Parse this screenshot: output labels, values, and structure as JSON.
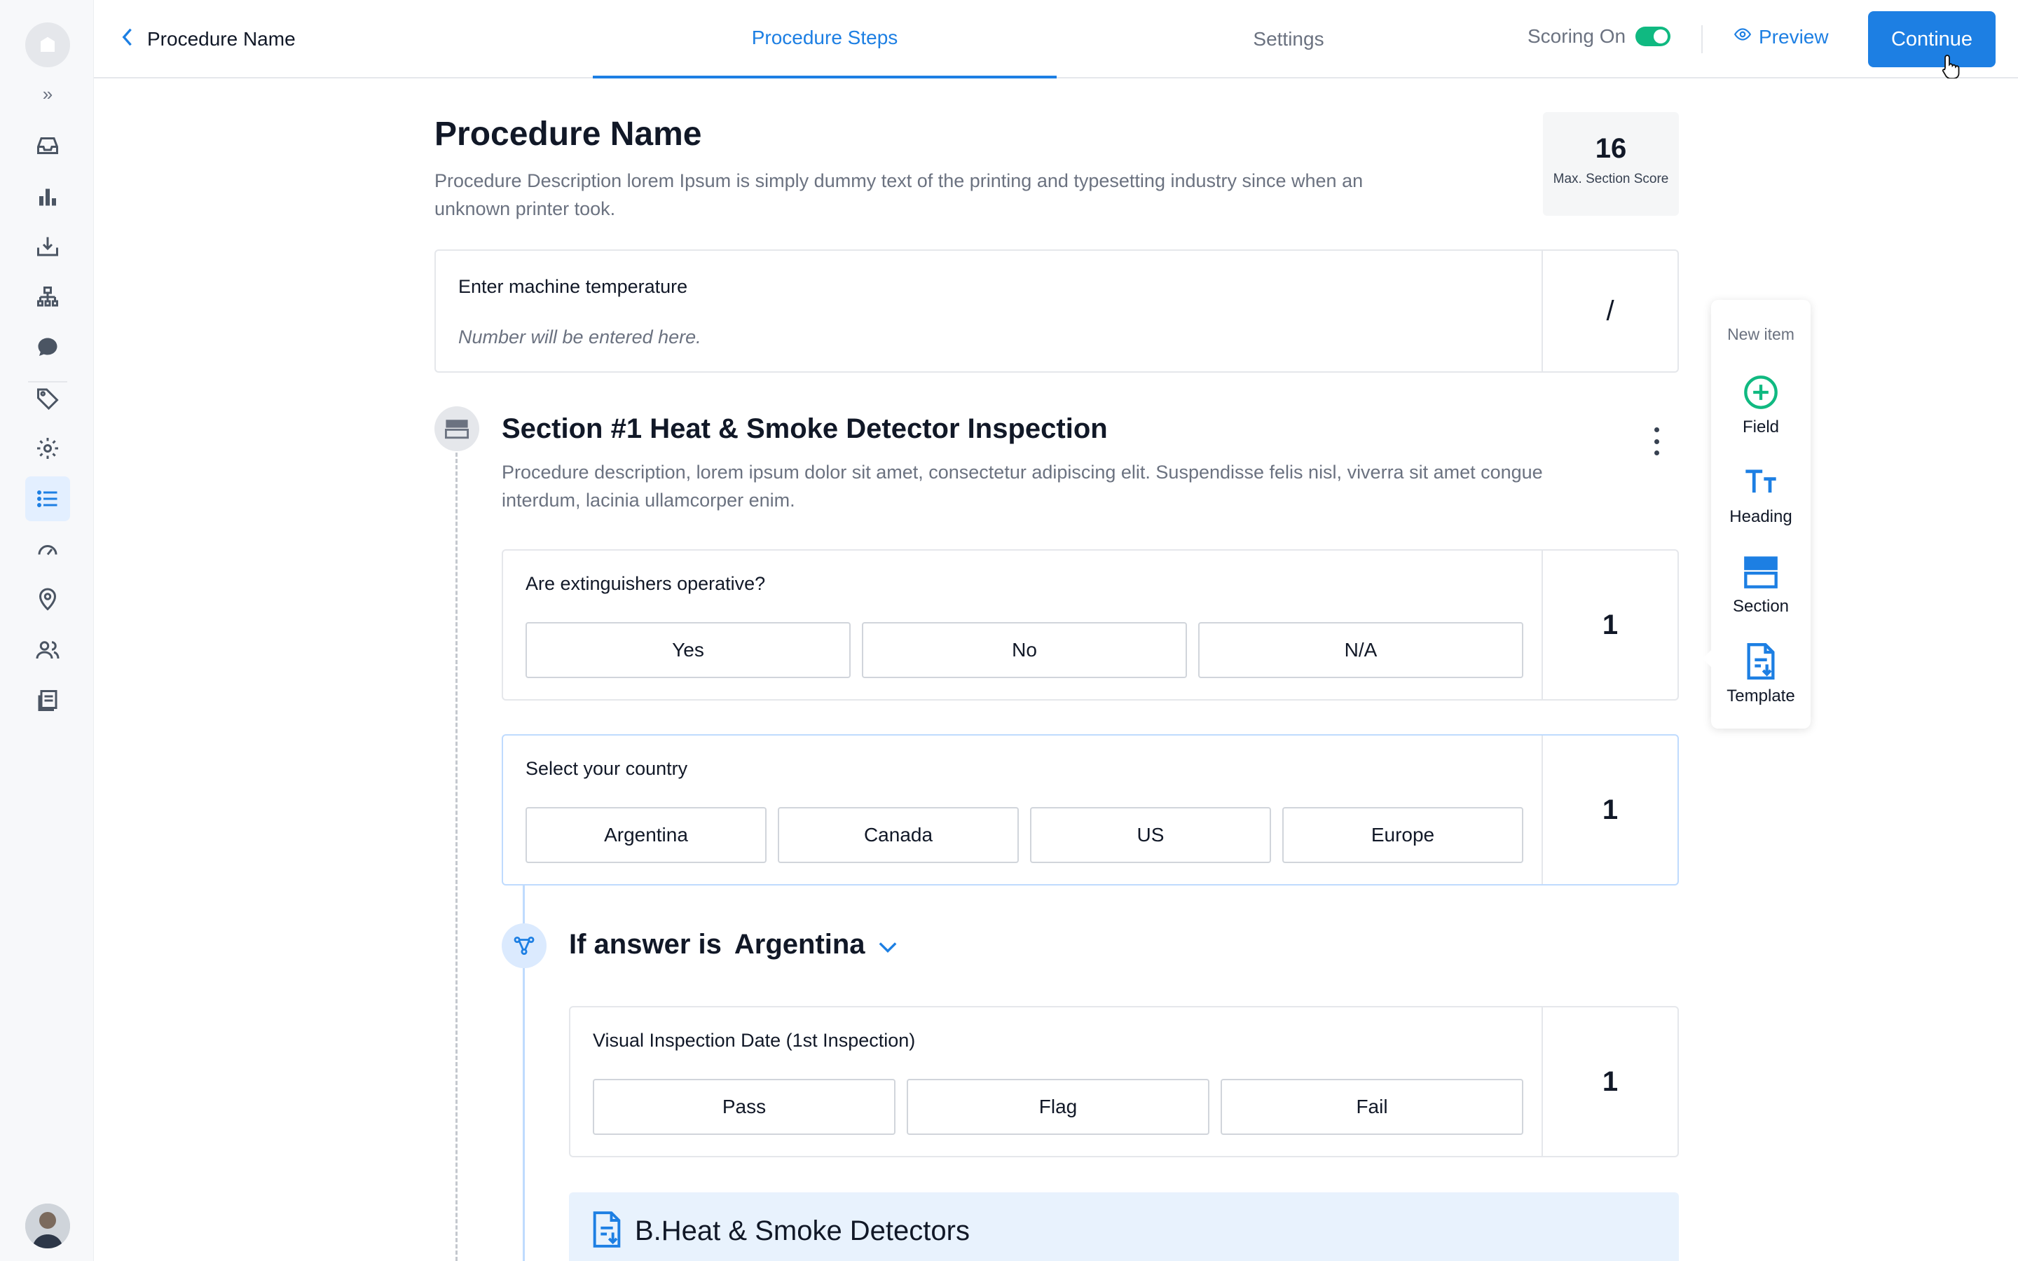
{
  "header": {
    "back_label": "Procedure Name",
    "tabs": [
      {
        "label": "Procedure Steps",
        "active": true
      },
      {
        "label": "Settings",
        "active": false
      }
    ],
    "scoring_label": "Scoring On",
    "preview_label": "Preview",
    "continue_label": "Continue"
  },
  "procedure": {
    "title": "Procedure Name",
    "description": "Procedure Description lorem Ipsum is simply dummy text of the printing and typesetting industry since when an unknown printer took.",
    "max_score_value": "16",
    "max_score_label": "Max. Section Score"
  },
  "temperature_field": {
    "label": "Enter machine temperature",
    "placeholder": "Number will be entered here.",
    "score": "/"
  },
  "section": {
    "title": "Section #1 Heat & Smoke Detector Inspection",
    "description": "Procedure description, lorem ipsum dolor sit amet, consectetur adipiscing elit. Suspendisse felis nisl, viverra sit amet congue interdum, lacinia ullamcorper enim."
  },
  "q_extinguishers": {
    "label": "Are extinguishers operative?",
    "options": [
      "Yes",
      "No",
      "N/A"
    ],
    "score": "1"
  },
  "q_country": {
    "label": "Select your country",
    "options": [
      "Argentina",
      "Canada",
      "US",
      "Europe"
    ],
    "score": "1"
  },
  "condition": {
    "prefix": "If answer is",
    "value": "Argentina"
  },
  "q_visual": {
    "label": "Visual Inspection Date (1st Inspection)",
    "options": [
      "Pass",
      "Flag",
      "Fail"
    ],
    "score": "1"
  },
  "template_block": {
    "title": "B.Heat & Smoke Detectors"
  },
  "new_item_panel": {
    "heading": "New item",
    "items": [
      {
        "label": "Field",
        "icon": "plus-circle-icon"
      },
      {
        "label": "Heading",
        "icon": "text-size-icon"
      },
      {
        "label": "Section",
        "icon": "section-icon"
      },
      {
        "label": "Template",
        "icon": "document-download-icon"
      }
    ]
  },
  "colors": {
    "accent": "#1d7fe3",
    "toggle_on": "#10b981",
    "field_icon": "#10b981"
  }
}
